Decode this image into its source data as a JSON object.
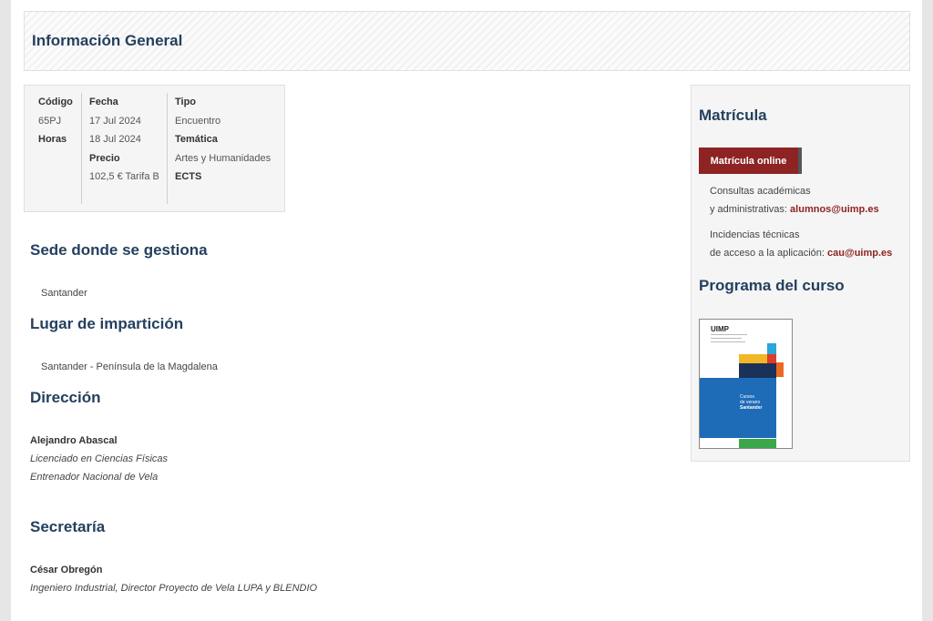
{
  "header": {
    "title": "Información General"
  },
  "info": {
    "codigo_label": "Código",
    "codigo_value": "65PJ",
    "horas_label": "Horas",
    "fecha_label": "Fecha",
    "fecha_start": "17 Jul 2024",
    "fecha_end": "18 Jul 2024",
    "precio_label": "Precio",
    "precio_value": "102,5 € Tarifa B",
    "tipo_label": "Tipo",
    "tipo_value": "Encuentro",
    "tematica_label": "Temática",
    "tematica_value": "Artes y Humanidades",
    "ects_label": "ECTS"
  },
  "sede": {
    "title": "Sede donde se gestiona",
    "value": "Santander"
  },
  "lugar": {
    "title": "Lugar de impartición",
    "value": "Santander - Península de la Magdalena"
  },
  "direccion": {
    "title": "Dirección",
    "name": "Alejandro Abascal",
    "roles": [
      "Licenciado en Ciencias Físicas",
      "Entrenador Nacional de Vela"
    ]
  },
  "secretaria": {
    "title": "Secretaría",
    "name": "César Obregón",
    "role": "Ingeniero Industrial, Director Proyecto de Vela LUPA y BLENDIO"
  },
  "sidebar": {
    "matricula_title": "Matrícula",
    "button_label": "Matrícula online",
    "consultas_line1": "Consultas académicas",
    "consultas_line2": "y administrativas:",
    "consultas_email": "alumnos@uimp.es",
    "incidencias_line1": "Incidencias técnicas",
    "incidencias_line2": "de acceso a la aplicación:",
    "incidencias_email": "cau@uimp.es",
    "programa_title": "Programa del curso"
  },
  "cover": {
    "logo": "UIMP",
    "text1": "Cursos",
    "text2": "de verano",
    "text3": "Santander"
  },
  "colors": {
    "heading": "#24405f",
    "accent": "#8e2323",
    "cover_blue": "#1e6bb8",
    "cover_navy": "#1c3158",
    "cover_yellow": "#f2b627",
    "cover_red": "#e03a2c",
    "cover_orange": "#ea6a22",
    "cover_cyan": "#2aa6d9",
    "cover_green": "#3aa84a"
  }
}
